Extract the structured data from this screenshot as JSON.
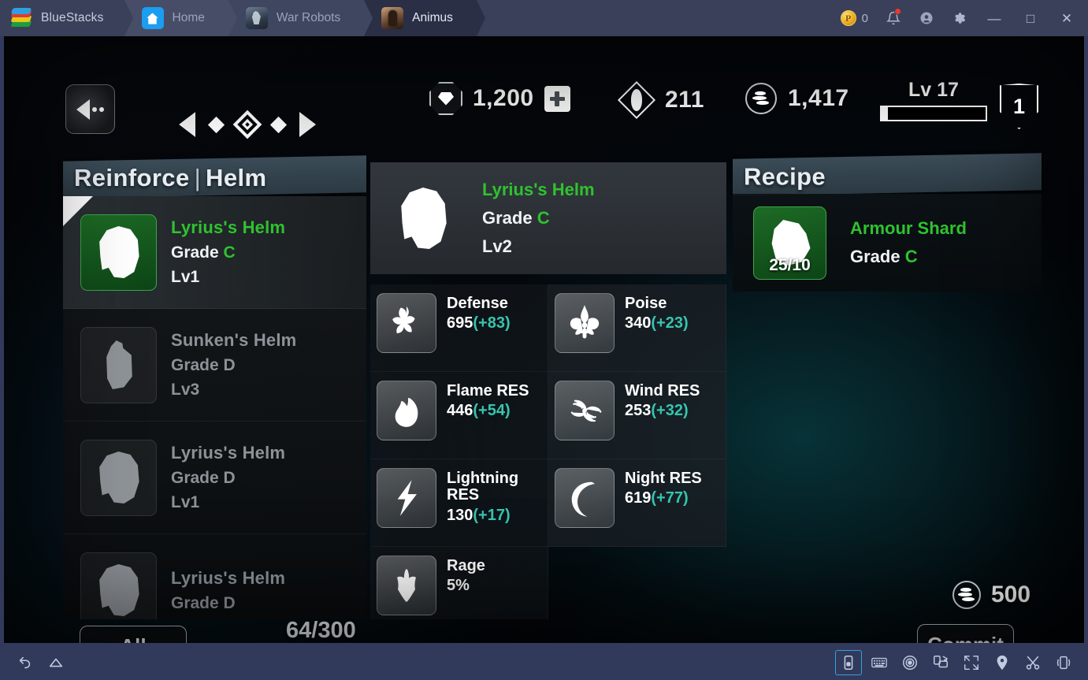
{
  "titlebar": {
    "brand": "BlueStacks",
    "tabs": [
      {
        "label": "Home",
        "icon": "home-icon",
        "active": false
      },
      {
        "label": "War Robots",
        "icon": "war-robots-app-icon",
        "active": false
      },
      {
        "label": "Animus",
        "icon": "animus-app-icon",
        "active": true
      }
    ],
    "points_value": "0",
    "points_icon": "points-coin-icon",
    "notifications_icon": "bell-icon",
    "account_icon": "account-icon",
    "settings_icon": "gear-icon",
    "minimize": "—",
    "maximize": "□",
    "close": "✕"
  },
  "hud": {
    "back_button": "back-button",
    "pager": {
      "prev": "prev-arrow-icon",
      "dot_left": "diamond-dot",
      "current": "diamond-selected",
      "dot_right": "diamond-dot",
      "next": "next-arrow-icon"
    },
    "resources": [
      {
        "icon": "gem-icon",
        "value": "1,200",
        "has_plus": true
      },
      {
        "icon": "soul-diamond-icon",
        "value": "211",
        "has_plus": false
      },
      {
        "icon": "coins-icon",
        "value": "1,417",
        "has_plus": false
      }
    ],
    "level_label": "Lv 17",
    "level_progress_percent": 6,
    "shield_value": "1"
  },
  "left_panel": {
    "title": "Reinforce",
    "separator": "|",
    "subtitle": "Helm",
    "items": [
      {
        "name": "Lyrius's Helm",
        "grade_label": "Grade",
        "grade": "C",
        "level": "Lv1",
        "selected": true,
        "icon": "helm-icon"
      },
      {
        "name": "Sunken's Helm",
        "grade_label": "Grade",
        "grade": "D",
        "level": "Lv3",
        "selected": false,
        "icon": "helm-icon"
      },
      {
        "name": "Lyrius's Helm",
        "grade_label": "Grade",
        "grade": "D",
        "level": "Lv1",
        "selected": false,
        "icon": "helm-icon"
      },
      {
        "name": "Lyrius's Helm",
        "grade_label": "Grade",
        "grade": "D",
        "level": "",
        "selected": false,
        "icon": "helm-icon"
      }
    ],
    "all_button": "All",
    "count": "64/300"
  },
  "center_panel": {
    "item": {
      "name": "Lyrius's Helm",
      "grade_label": "Grade",
      "grade": "C",
      "level": "Lv2",
      "icon": "helm-icon"
    },
    "stats": [
      {
        "icon": "defense-icon",
        "name": "Defense",
        "value": "695",
        "bonus": "(+83)"
      },
      {
        "icon": "poise-icon",
        "name": "Poise",
        "value": "340",
        "bonus": "(+23)"
      },
      {
        "icon": "flame-icon",
        "name": "Flame RES",
        "value": "446",
        "bonus": "(+54)"
      },
      {
        "icon": "wind-icon",
        "name": "Wind RES",
        "value": "253",
        "bonus": "(+32)"
      },
      {
        "icon": "lightning-icon",
        "name": "Lightning RES",
        "value": "130",
        "bonus": "(+17)"
      },
      {
        "icon": "moon-icon",
        "name": "Night RES",
        "value": "619",
        "bonus": "(+77)"
      },
      {
        "icon": "rage-icon",
        "name": "Rage",
        "value": "5%",
        "bonus": ""
      }
    ]
  },
  "right_panel": {
    "title": "Recipe",
    "material": {
      "name": "Armour Shard",
      "grade_label": "Grade",
      "grade": "C",
      "count": "25/10",
      "icon": "shard-icon"
    }
  },
  "footer": {
    "cost_icon": "coins-icon",
    "cost_value": "500",
    "commit_button": "Commit"
  },
  "bottombar": {
    "left": [
      {
        "icon": "back-nav-icon"
      },
      {
        "icon": "home-nav-icon"
      }
    ],
    "right": [
      {
        "icon": "multi-instance-icon",
        "selected": true
      },
      {
        "icon": "keyboard-icon",
        "selected": false
      },
      {
        "icon": "eye-icon",
        "selected": false
      },
      {
        "icon": "rotate-icon",
        "selected": false
      },
      {
        "icon": "fullscreen-icon",
        "selected": false
      },
      {
        "icon": "location-pin-icon",
        "selected": false
      },
      {
        "icon": "scissors-icon",
        "selected": false
      },
      {
        "icon": "shake-phone-icon",
        "selected": false
      }
    ]
  },
  "colors": {
    "accent_green": "#2fc22f",
    "bonus_teal": "#36c5b0",
    "titlebar_bg": "#3a4059",
    "toolbar_bg": "#323a5c",
    "panel_header": "#33434e"
  }
}
